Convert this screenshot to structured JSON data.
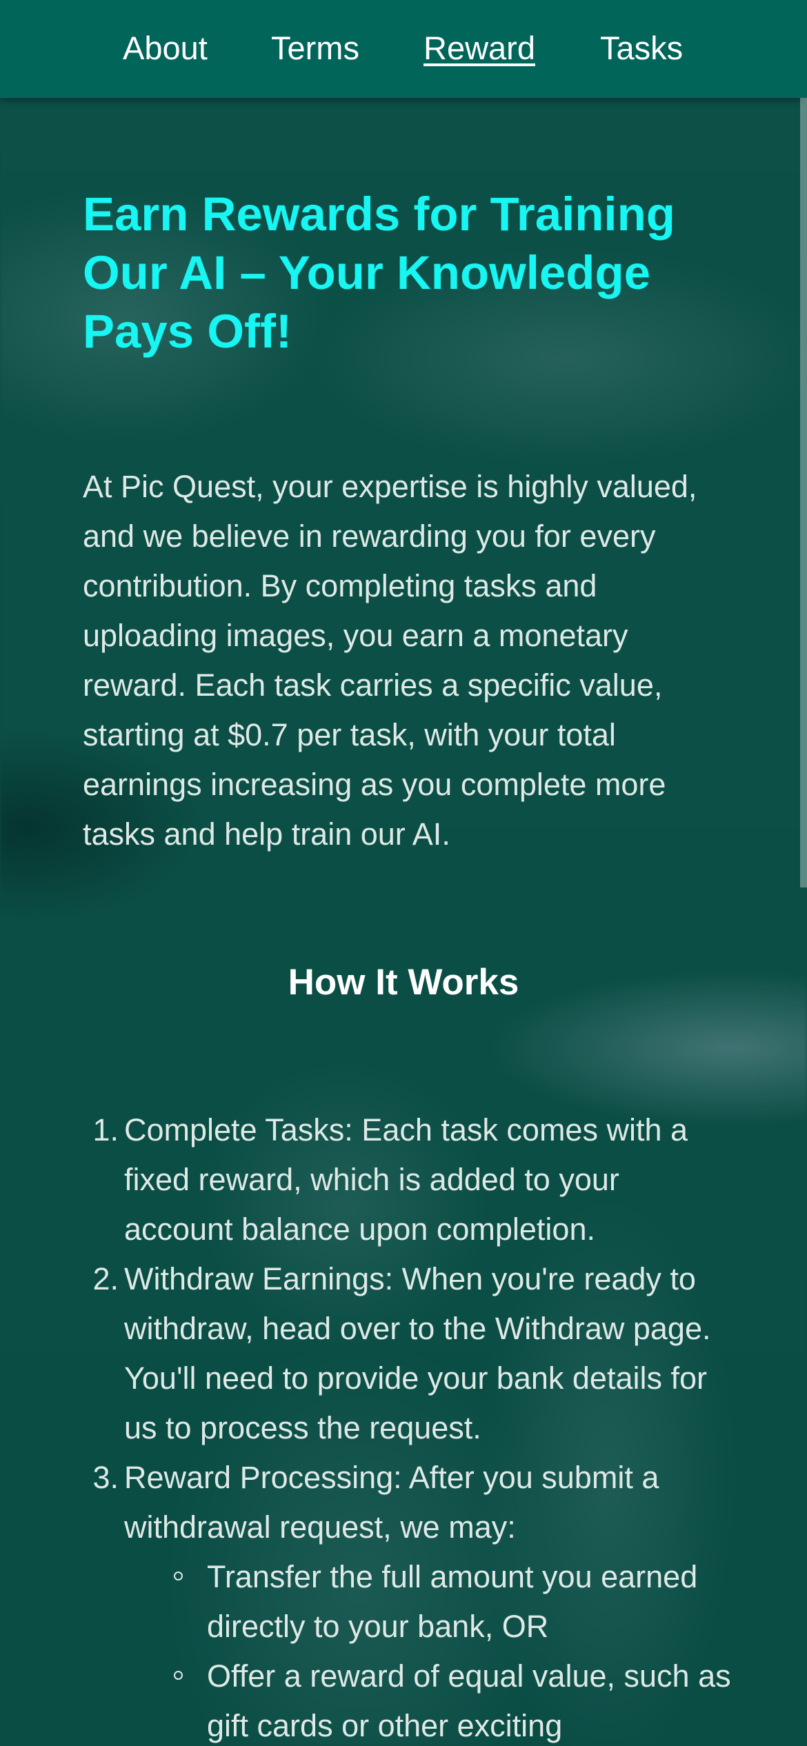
{
  "nav": {
    "items": [
      {
        "label": "About",
        "active": false
      },
      {
        "label": "Terms",
        "active": false
      },
      {
        "label": "Reward",
        "active": true
      },
      {
        "label": "Tasks",
        "active": false
      }
    ]
  },
  "main": {
    "title": "Earn Rewards for Training Our AI – Your Knowledge Pays Off!",
    "intro": "At Pic Quest, your expertise is highly valued, and we believe in rewarding you for every contribution. By completing tasks and uploading images, you earn a monetary reward. Each task carries a specific value, starting at $0.7 per task, with your total earnings increasing as you complete more tasks and help train our AI.",
    "how_it_works": {
      "heading": "How It Works",
      "steps": [
        {
          "number": "1.",
          "text": "Complete Tasks: Each task comes with a fixed reward, which is added to your account balance upon completion."
        },
        {
          "number": "2.",
          "text": "Withdraw Earnings: When you're ready to withdraw, head over to the Withdraw page. You'll need to provide your bank details for us to process the request."
        },
        {
          "number": "3.",
          "text": "Reward Processing: After you submit a withdrawal request, we may:"
        }
      ],
      "sub_options": [
        "Transfer the full amount you earned directly to your bank, OR",
        "Offer a reward of equal value, such as gift cards or other exciting"
      ]
    }
  },
  "colors": {
    "nav_bg": "#02655a",
    "page_bg": "#0b4d45",
    "title": "#17f6f2",
    "body_text": "#dfe9e6"
  }
}
